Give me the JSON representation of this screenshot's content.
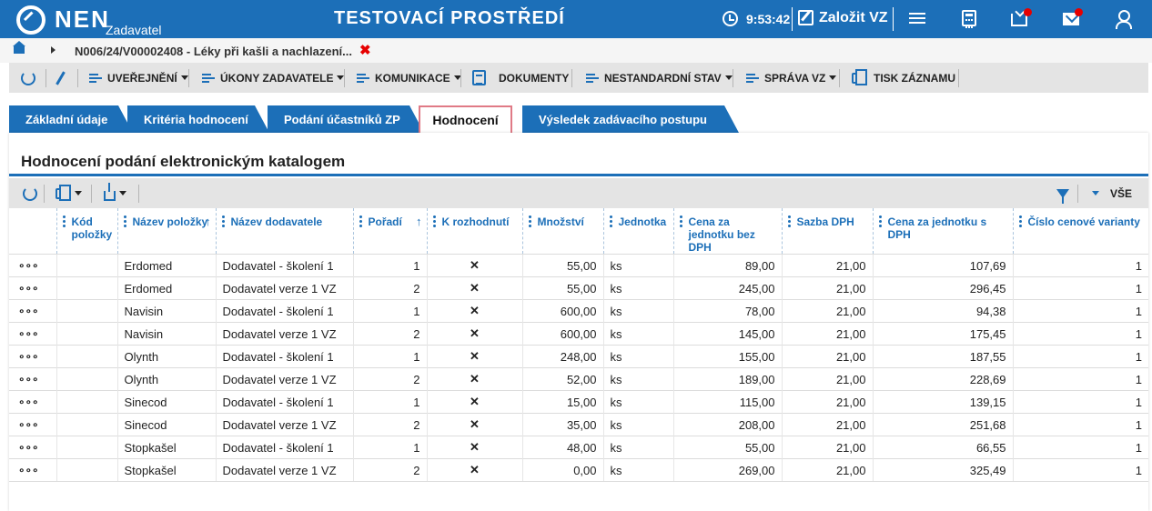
{
  "header": {
    "brand": "NEN",
    "brand_sub": "Zadavatel",
    "environment": "TESTOVACÍ PROSTŘEDÍ",
    "time": "9:53:42",
    "create_label": "Založit VZ",
    "colors": {
      "primary": "#1c6fb8",
      "notification": "#e60000"
    }
  },
  "breadcrumb": {
    "path": "N006/24/V00002408 - Léky při kašli a nachlazení...",
    "close_symbol": "✖"
  },
  "actions": {
    "uverejneni": "UVEŘEJNĚNÍ",
    "ukony": "ÚKONY ZADAVATELE",
    "komunikace": "KOMUNIKACE",
    "dokumenty": "DOKUMENTY",
    "nestandardni": "NESTANDARDNÍ STAV",
    "sprava": "SPRÁVA VZ",
    "tisk": "TISK ZÁZNAMU"
  },
  "tabs": [
    {
      "label": "Základní údaje"
    },
    {
      "label": "Kritéria hodnocení"
    },
    {
      "label": "Podání účastníků ZP"
    },
    {
      "label": "Hodnocení"
    },
    {
      "label": "Výsledek zadávacího postupu"
    }
  ],
  "panel": {
    "title": "Hodnocení podání elektronickým katalogem",
    "filter_all": "VŠE"
  },
  "grid": {
    "columns": [
      {
        "label": ""
      },
      {
        "label": "Kód položky"
      },
      {
        "label": "Název položky"
      },
      {
        "label": "Název dodavatele"
      },
      {
        "label": "Pořadí"
      },
      {
        "label": "K rozhodnutí"
      },
      {
        "label": "Množství"
      },
      {
        "label": "Jednotka"
      },
      {
        "label": "Cena za jednotku bez DPH"
      },
      {
        "label": "Sazba DPH"
      },
      {
        "label": "Cena za jednotku s DPH"
      },
      {
        "label": "Číslo cenové varianty"
      }
    ],
    "row_menu": "∘∘∘",
    "x_mark": "✕",
    "rows": [
      {
        "kod": "",
        "nazev": "Erdomed",
        "dodavatel": "Dodavatel - školení 1",
        "poradi": "1",
        "mnozstvi": "55,00",
        "jednotka": "ks",
        "cena_bez": "89,00",
        "sazba": "21,00",
        "cena_s": "107,69",
        "varianta": "1"
      },
      {
        "kod": "",
        "nazev": "Erdomed",
        "dodavatel": "Dodavatel verze 1 VZ",
        "poradi": "2",
        "mnozstvi": "55,00",
        "jednotka": "ks",
        "cena_bez": "245,00",
        "sazba": "21,00",
        "cena_s": "296,45",
        "varianta": "1"
      },
      {
        "kod": "",
        "nazev": "Navisin",
        "dodavatel": "Dodavatel - školení 1",
        "poradi": "1",
        "mnozstvi": "600,00",
        "jednotka": "ks",
        "cena_bez": "78,00",
        "sazba": "21,00",
        "cena_s": "94,38",
        "varianta": "1"
      },
      {
        "kod": "",
        "nazev": "Navisin",
        "dodavatel": "Dodavatel verze 1 VZ",
        "poradi": "2",
        "mnozstvi": "600,00",
        "jednotka": "ks",
        "cena_bez": "145,00",
        "sazba": "21,00",
        "cena_s": "175,45",
        "varianta": "1"
      },
      {
        "kod": "",
        "nazev": "Olynth",
        "dodavatel": "Dodavatel - školení 1",
        "poradi": "1",
        "mnozstvi": "248,00",
        "jednotka": "ks",
        "cena_bez": "155,00",
        "sazba": "21,00",
        "cena_s": "187,55",
        "varianta": "1"
      },
      {
        "kod": "",
        "nazev": "Olynth",
        "dodavatel": "Dodavatel verze 1 VZ",
        "poradi": "2",
        "mnozstvi": "52,00",
        "jednotka": "ks",
        "cena_bez": "189,00",
        "sazba": "21,00",
        "cena_s": "228,69",
        "varianta": "1"
      },
      {
        "kod": "",
        "nazev": "Sinecod",
        "dodavatel": "Dodavatel - školení 1",
        "poradi": "1",
        "mnozstvi": "15,00",
        "jednotka": "ks",
        "cena_bez": "115,00",
        "sazba": "21,00",
        "cena_s": "139,15",
        "varianta": "1"
      },
      {
        "kod": "",
        "nazev": "Sinecod",
        "dodavatel": "Dodavatel verze 1 VZ",
        "poradi": "2",
        "mnozstvi": "35,00",
        "jednotka": "ks",
        "cena_bez": "208,00",
        "sazba": "21,00",
        "cena_s": "251,68",
        "varianta": "1"
      },
      {
        "kod": "",
        "nazev": "Stopkašel",
        "dodavatel": "Dodavatel - školení 1",
        "poradi": "1",
        "mnozstvi": "48,00",
        "jednotka": "ks",
        "cena_bez": "55,00",
        "sazba": "21,00",
        "cena_s": "66,55",
        "varianta": "1"
      },
      {
        "kod": "",
        "nazev": "Stopkašel",
        "dodavatel": "Dodavatel verze 1 VZ",
        "poradi": "2",
        "mnozstvi": "0,00",
        "jednotka": "ks",
        "cena_bez": "269,00",
        "sazba": "21,00",
        "cena_s": "325,49",
        "varianta": "1"
      }
    ]
  }
}
